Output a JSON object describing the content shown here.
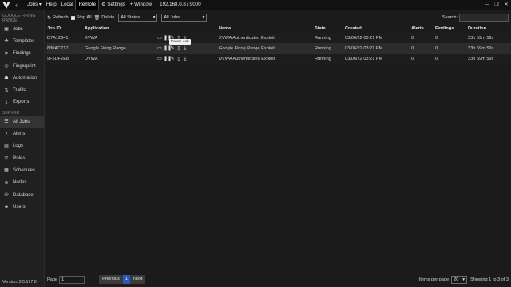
{
  "topbar": {
    "menu": [
      "Jobs",
      "Help",
      "Local",
      "Remote",
      "Settings",
      "+ Window"
    ],
    "active": "Remote",
    "ip": "192.168.0.87:9000"
  },
  "sidebar": {
    "sections": [
      {
        "title": "GOOGLE FIRING RANGE",
        "items": [
          {
            "label": "Jobs",
            "icon": "briefcase-icon"
          },
          {
            "label": "Templates",
            "icon": "puzzle-icon"
          },
          {
            "label": "Findings",
            "icon": "flag-icon"
          },
          {
            "label": "Fingerprint",
            "icon": "fingerprint-icon"
          },
          {
            "label": "Automation",
            "icon": "robot-icon"
          },
          {
            "label": "Traffic",
            "icon": "traffic-icon"
          },
          {
            "label": "Exports",
            "icon": "download-icon"
          }
        ]
      },
      {
        "title": "SERVER",
        "items": [
          {
            "label": "All Jobs",
            "icon": "jobs-icon",
            "active": true
          },
          {
            "label": "Alerts",
            "icon": "bell-icon"
          },
          {
            "label": "Logs",
            "icon": "logs-icon"
          },
          {
            "label": "Rules",
            "icon": "rules-icon"
          },
          {
            "label": "Schedules",
            "icon": "calendar-icon"
          },
          {
            "label": "Nodes",
            "icon": "nodes-icon"
          },
          {
            "label": "Database",
            "icon": "database-icon"
          },
          {
            "label": "Users",
            "icon": "users-icon"
          }
        ]
      }
    ],
    "version": "Version: 3.5.177.0"
  },
  "toolbar": {
    "refresh": "Refresh",
    "stop_all": "Stop All",
    "delete": "Delete",
    "state_filter": "All States",
    "jobs_filter": "All Jobs",
    "search_label": "Search:"
  },
  "table": {
    "headers": [
      "Job ID",
      "Application",
      "",
      "Name",
      "State",
      "Created",
      "Alerts",
      "Findings",
      "Duration"
    ],
    "rows": [
      {
        "id": "D7A12641",
        "app": "XVWA",
        "name": "XVWA Authenticated Exploit",
        "state": "Running",
        "created": "03/06/22 03:21 PM",
        "alerts": "0",
        "findings": "0",
        "duration": "23h 59m 59s"
      },
      {
        "id": "830AC717",
        "app": "Google Firing Range",
        "name": "Google Firing Range Exploit",
        "state": "Running",
        "created": "03/06/22 03:21 PM",
        "alerts": "0",
        "findings": "0",
        "duration": "23h 59m 59s"
      },
      {
        "id": "9F5DF2E8",
        "app": "DVWA",
        "name": "DVWA Authenticated Exploit",
        "state": "Running",
        "created": "03/06/22 03:21 PM",
        "alerts": "0",
        "findings": "0",
        "duration": "23h 59m 59s"
      }
    ],
    "tooltip": "Pause Job"
  },
  "footer": {
    "page_label": "Page",
    "page_value": "1",
    "previous": "Previous",
    "current": "1",
    "next": "Next",
    "items_label": "Items per page",
    "items_value": "20",
    "showing": "Showing 1 to 3 of 3"
  }
}
